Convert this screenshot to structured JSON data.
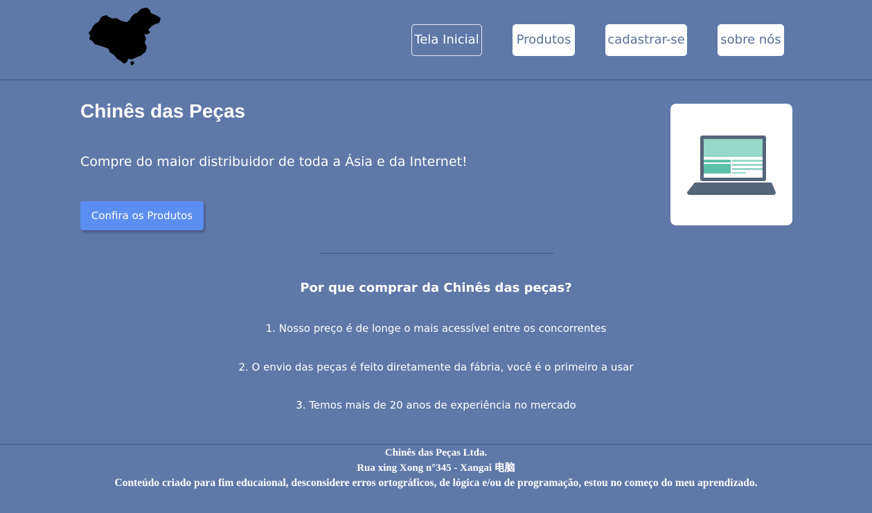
{
  "header": {
    "logo_icon": "china-map-icon",
    "nav": {
      "home": "Tela Inicial",
      "products": "Produtos",
      "signup": "cadastrar-se",
      "about": "sobre nós"
    }
  },
  "hero": {
    "title": "Chinês das Peças",
    "subtitle": "Compre do maior distribuidor de toda a Ásia e da Internet!",
    "cta_label": "Confira os Produtos",
    "image_icon": "laptop-icon"
  },
  "why": {
    "title": "Por que comprar da Chinês das peças?",
    "reasons": [
      "1. Nosso preço é de longe o mais acessível entre os concorrentes",
      "2. O envio das peças é feito diretamente da fábria, você é o primeiro a usar",
      "3. Temos mais de 20 anos de experiência no mercado"
    ]
  },
  "footer": {
    "company": "Chinês das Peças Ltda.",
    "address": "Rua xing Xong n°345 - Xangai 电脑",
    "disclaimer": "Conteúdo criado para fim educaional, desconsidere erros ortográficos, de lógica e/ou de programação, estou no começo do meu aprendizado."
  },
  "colors": {
    "background": "#6078a8",
    "cta": "#5b8ef0",
    "nav_text": "#5a6f9c",
    "laptop_body": "#55657a",
    "laptop_screen": "#97d8c9",
    "laptop_accent": "#5cbfa8"
  }
}
